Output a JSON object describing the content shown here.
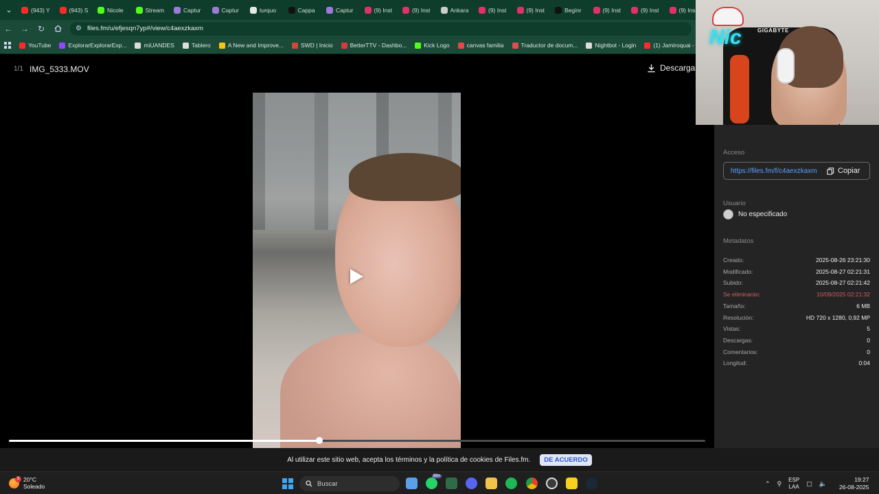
{
  "browser": {
    "tabs": [
      {
        "label": "(943) Y",
        "color": "#ff2a2a"
      },
      {
        "label": "(943) S",
        "color": "#ff2a2a"
      },
      {
        "label": "Nicole",
        "color": "#53fc18"
      },
      {
        "label": "Stream",
        "color": "#53fc18"
      },
      {
        "label": "Captur",
        "color": "#9b7bd8"
      },
      {
        "label": "Captur",
        "color": "#9b7bd8"
      },
      {
        "label": "turquo",
        "color": "#e8e8e8"
      },
      {
        "label": "Cappa",
        "color": "#111111"
      },
      {
        "label": "Captur",
        "color": "#9b7bd8"
      },
      {
        "label": "(9) Inst",
        "color": "#e1306c"
      },
      {
        "label": "(9) Inst",
        "color": "#e1306c"
      },
      {
        "label": "Ankara",
        "color": "#cccccc"
      },
      {
        "label": "(9) Inst",
        "color": "#e1306c"
      },
      {
        "label": "(9) Inst",
        "color": "#e1306c"
      },
      {
        "label": "Beginr",
        "color": "#111111"
      },
      {
        "label": "(9) Inst",
        "color": "#e1306c"
      },
      {
        "label": "(9) Inst",
        "color": "#e1306c"
      },
      {
        "label": "(9) Ins",
        "color": "#e1306c"
      }
    ],
    "url": "files.fm/u/efjesqn7yp#/view/c4aexzkaxm",
    "bookmarks": [
      {
        "label": "YouTube",
        "color": "#ff2a2a"
      },
      {
        "label": "ExplorarExplorarExp...",
        "color": "#9146ff"
      },
      {
        "label": "miUANDES",
        "color": "#dddddd"
      },
      {
        "label": "Tablero",
        "color": "#dddddd"
      },
      {
        "label": "A New and Improve...",
        "color": "#f5c518"
      },
      {
        "label": "SWD | Inicio",
        "color": "#c84b3a"
      },
      {
        "label": "BetterTTV - Dashbo...",
        "color": "#d23c3c"
      },
      {
        "label": "Kick Logo",
        "color": "#53fc18"
      },
      {
        "label": "canvas familia",
        "color": "#e04a4a"
      },
      {
        "label": "Traductor de docum...",
        "color": "#d95050"
      },
      {
        "label": "Nightbot - Login",
        "color": "#dddddd"
      },
      {
        "label": "(1) Jamiroquai - Can...",
        "color": "#ff2a2a"
      }
    ]
  },
  "viewer": {
    "counter": "1/1",
    "filename": "IMG_5333.MOV",
    "download_label": "Descargar",
    "progress": 0.446
  },
  "webcam": {
    "brand": "GIGABYTE",
    "logo": "Nic"
  },
  "panel": {
    "access_label": "Acceso",
    "access_url": "https://files.fm/f/c4aexzkaxm",
    "copy_label": "Copiar",
    "user_label": "Usuario",
    "user_value": "No especificado",
    "metadata_label": "Metadatos",
    "metadata": [
      {
        "key": "Creado:",
        "value": "2025-08-26 23:21:30"
      },
      {
        "key": "Modificado:",
        "value": "2025-08-27 02:21:31"
      },
      {
        "key": "Subido:",
        "value": "2025-08-27 02:21:42"
      },
      {
        "key": "Se eliminarán:",
        "value": "10/09/2025 02:21:32",
        "warn": true
      },
      {
        "key": "Tamaño:",
        "value": "6 MB"
      },
      {
        "key": "Resolución:",
        "value": "HD 720 x 1280, 0,92 MP"
      },
      {
        "key": "Vistas:",
        "value": "5"
      },
      {
        "key": "Descargas:",
        "value": "0"
      },
      {
        "key": "Comentarios:",
        "value": "0"
      },
      {
        "key": "Longitud:",
        "value": "0:04"
      }
    ]
  },
  "cookie": {
    "text": "Al utilizar este sitio web, acepta los términos y la política de cookies de Files.fm.",
    "accept_label": "DE ACUERDO"
  },
  "taskbar": {
    "weather_temp": "20°C",
    "weather_desc": "Soleado",
    "weather_badge": "3",
    "search_placeholder": "Buscar",
    "whatsapp_badge": "99+",
    "lang_top": "ESP",
    "lang_bottom": "LAA",
    "time": "19:27",
    "date": "26-08-2025"
  }
}
